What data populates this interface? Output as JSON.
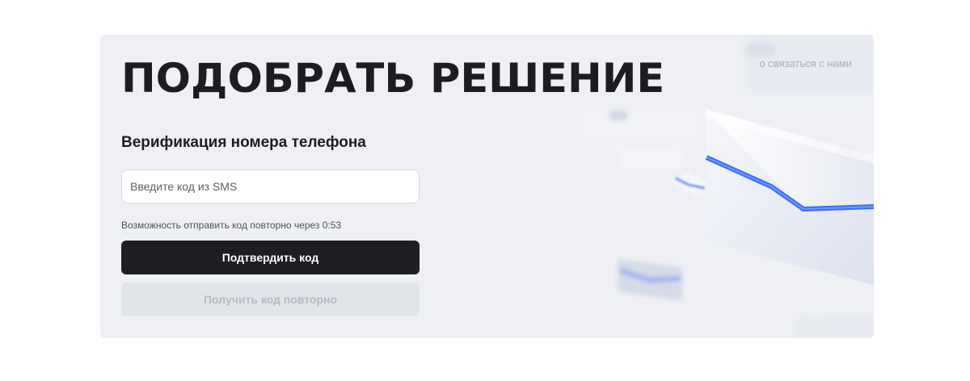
{
  "page": {
    "title": "ПОДОБРАТЬ РЕШЕНИЕ",
    "contact_link": "о связаться с нами"
  },
  "form": {
    "heading": "Верификация номера телефона",
    "code_input": {
      "placeholder": "Введите код из SMS",
      "value": ""
    },
    "resend_note": "Возможность отправить код повторно через 0:53",
    "confirm_button": "Подтвердить код",
    "resend_button": "Получить код повторно"
  },
  "colors": {
    "card_background": "#eef0f4",
    "primary_button": "#1e1f23",
    "disabled_button": "#e1e4e9",
    "envelope_accent": "#4a7dff"
  },
  "icons": {
    "decoration": "envelope-illustration"
  }
}
